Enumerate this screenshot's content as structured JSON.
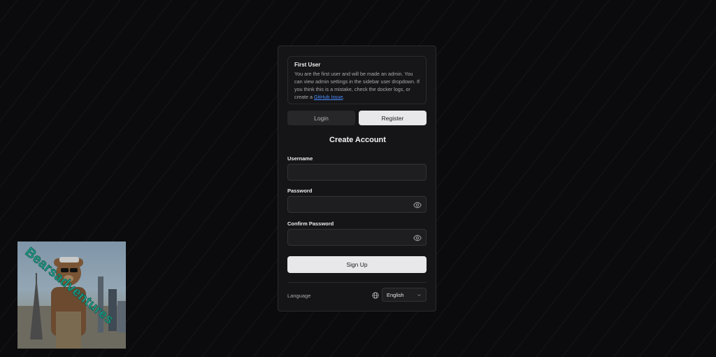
{
  "notice": {
    "title": "First User",
    "body": "You are the first user and will be made an admin. You can view admin settings in the sidebar user dropdown. If you think this is a mistake, check the docker logs, or create a ",
    "link": "GitHub Issue",
    "suffix": "."
  },
  "tabs": [
    {
      "label": "Login",
      "active": false
    },
    {
      "label": "Register",
      "active": true
    }
  ],
  "heading": "Create Account",
  "fields": {
    "username": {
      "label": "Username",
      "value": ""
    },
    "password": {
      "label": "Password",
      "value": ""
    },
    "confirm_password": {
      "label": "Confirm Password",
      "value": ""
    }
  },
  "signup_label": "Sign Up",
  "language": {
    "label": "Language",
    "selected": "English"
  },
  "poster": {
    "watermark": "Bearsadventures"
  },
  "colors": {
    "background": "#0b0b0d",
    "card": "#151517",
    "primary_button": "#e8e8ea",
    "link": "#4a8cff"
  },
  "icons": {
    "password_toggle": "eye-icon",
    "language": "globe-icon",
    "select": "chevron-down-icon"
  }
}
